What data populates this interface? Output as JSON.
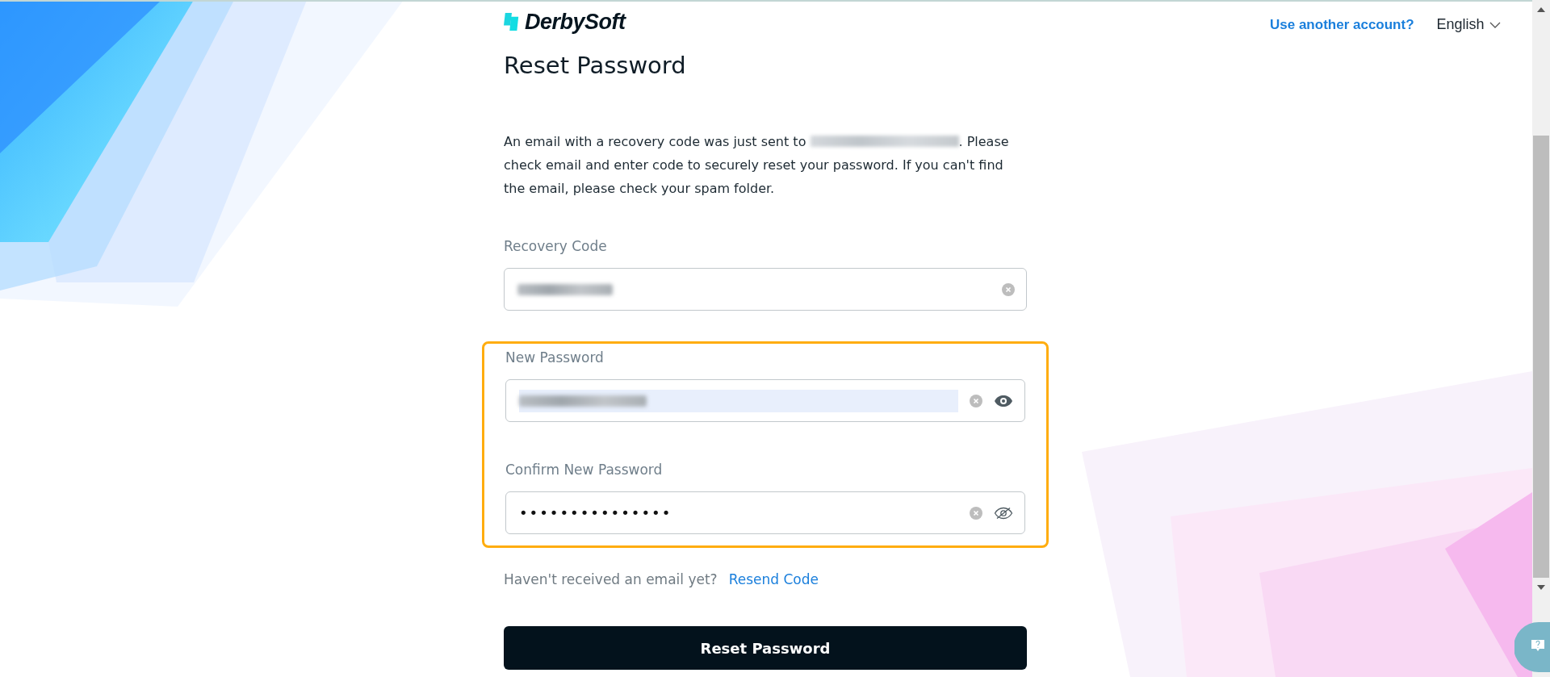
{
  "brand": {
    "name": "DerbySoft"
  },
  "header": {
    "switch_account": "Use another account?",
    "language": "English"
  },
  "title": "Reset Password",
  "message": {
    "before": "An email with a recovery code was just sent to",
    "after": ". Please check email and enter code to securely reset your password. If you can't find the email, please check your spam folder."
  },
  "fields": [
    {
      "label": "Recovery Code",
      "kind": "text",
      "redacted": true,
      "selected": false,
      "highlighted": false,
      "clearable": true
    },
    {
      "label": "New Password",
      "kind": "password",
      "redacted": true,
      "selected": true,
      "highlighted": true,
      "clearable": true,
      "revealed": true
    },
    {
      "label": "Confirm New Password",
      "kind": "password",
      "value": "•••••••••••••••",
      "redacted": false,
      "selected": false,
      "highlighted": true,
      "clearable": true,
      "revealed": false
    }
  ],
  "resend": {
    "prompt": "Haven't received an email yet?",
    "link": "Resend Code"
  },
  "submit": "Reset Password"
}
